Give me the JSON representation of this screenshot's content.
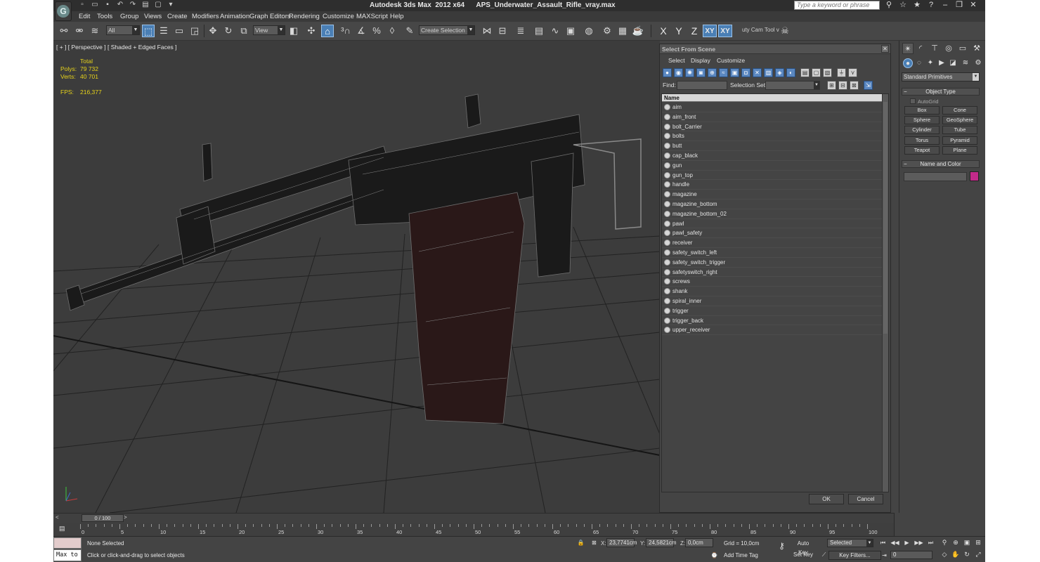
{
  "titlebar": {
    "window_title": "Autodesk 3ds Max  2012 x64      APS_Underwater_Assault_Rifle_vray.max",
    "search_placeholder": "Type a keyword or phrase",
    "app_logo": "3ds-max-logo",
    "quick_access_icons": [
      "new-file-icon",
      "open-file-icon",
      "save-icon",
      "undo-icon",
      "redo-icon",
      "hold-icon",
      "fetch-icon",
      "project-folder-icon"
    ],
    "right_icons": [
      "binoculars-icon",
      "star-icon",
      "star-icon",
      "help-icon",
      "minimize-icon",
      "restore-icon",
      "close-icon"
    ]
  },
  "menubar": {
    "items": [
      "Edit",
      "Tools",
      "Group",
      "Views",
      "Create",
      "Modifiers",
      "Animation",
      "Graph Editors",
      "Rendering",
      "Customize",
      "MAXScript",
      "Help"
    ]
  },
  "toolbar": {
    "selection_filter": "All",
    "reference_coord": "View",
    "named_selection": "Create Selection Se",
    "axis_buttons": [
      "X",
      "Y",
      "Z",
      "XY",
      "XY"
    ],
    "cam_tool_label": "uty Cam Tool v",
    "icons": [
      "link-icon",
      "unlink-icon",
      "bind-spacewarp-icon",
      "select-object-icon",
      "select-by-name-icon",
      "rectangular-selection-icon",
      "window-crossing-icon",
      "move-icon",
      "rotate-icon",
      "scale-icon",
      "pivot-icon",
      "manipulate-icon",
      "snaps-toggle-icon",
      "angle-snap-icon",
      "percent-snap-icon",
      "spinner-snap-icon",
      "edit-named-selection-icon",
      "mirror-icon",
      "align-icon",
      "layer-manager-icon",
      "graphite-icon",
      "curve-editor-icon",
      "schematic-view-icon",
      "material-editor-icon",
      "render-setup-icon",
      "rendered-frame-icon",
      "render-icon"
    ]
  },
  "viewport": {
    "label": "[ + ] [ Perspective ] [ Shaded + Edged Faces ]",
    "stats": {
      "header": "Total",
      "polys_label": "Polys:",
      "polys_value": "79 732",
      "verts_label": "Verts:",
      "verts_value": "40 701",
      "fps_label": "FPS:",
      "fps_value": "216,377"
    },
    "stats_color": "#e6d21a"
  },
  "select_dialog": {
    "title": "Select From Scene",
    "menu": [
      "Select",
      "Display",
      "Customize"
    ],
    "find_label": "Find:",
    "selection_set_label": "Selection Set:",
    "column_header": "Name",
    "objects": [
      "aim",
      "aim_front",
      "bolt_Carrier",
      "bolts",
      "butt",
      "cap_black",
      "gun",
      "gun_top",
      "handle",
      "magazine",
      "magazine_bottom",
      "magazine_bottom_02",
      "pawl",
      "pawl_safety",
      "receiver",
      "safety_switch_left",
      "safety_switch_trigger",
      "safetyswitch_right",
      "screws",
      "shank",
      "spiral_inner",
      "trigger",
      "trigger_back",
      "upper_receiver"
    ],
    "ok_label": "OK",
    "cancel_label": "Cancel"
  },
  "command_panel": {
    "category": "Standard Primitives",
    "object_type_title": "Object Type",
    "autogrid_label": "AutoGrid",
    "primitives": [
      "Box",
      "Cone",
      "Sphere",
      "GeoSphere",
      "Cylinder",
      "Tube",
      "Torus",
      "Pyramid",
      "Teapot",
      "Plane"
    ],
    "name_color_title": "Name and Color",
    "swatch_color": "#c22a8a",
    "tab_icons": [
      "create-icon",
      "modify-icon",
      "hierarchy-icon",
      "motion-icon",
      "display-icon",
      "utilities-icon"
    ],
    "sub_icons": [
      "geometry-icon",
      "shapes-icon",
      "lights-icon",
      "cameras-icon",
      "helpers-icon",
      "spacewarps-icon",
      "systems-icon"
    ]
  },
  "timeline": {
    "slider_label": "0 / 100",
    "tick_labels": [
      "0",
      "5",
      "10",
      "15",
      "20",
      "25",
      "30",
      "35",
      "40",
      "45",
      "50",
      "55",
      "60",
      "65",
      "70",
      "75",
      "80",
      "85",
      "90",
      "95",
      "100"
    ]
  },
  "statusbar": {
    "maxscript_label": "Max to",
    "selection_status": "None Selected",
    "prompt": "Click or click-and-drag to select objects",
    "x_label": "X:",
    "x_value": "23,7741cm",
    "y_label": "Y:",
    "y_value": "24,5821cm",
    "z_label": "Z:",
    "z_value": "0,0cm",
    "grid": "Grid = 10,0cm",
    "add_time_tag": "Add Time Tag",
    "auto_key": "Auto Key",
    "set_key": "Set Key",
    "key_mode": "Selected",
    "key_filters": "Key Filters...",
    "frame": "0"
  }
}
